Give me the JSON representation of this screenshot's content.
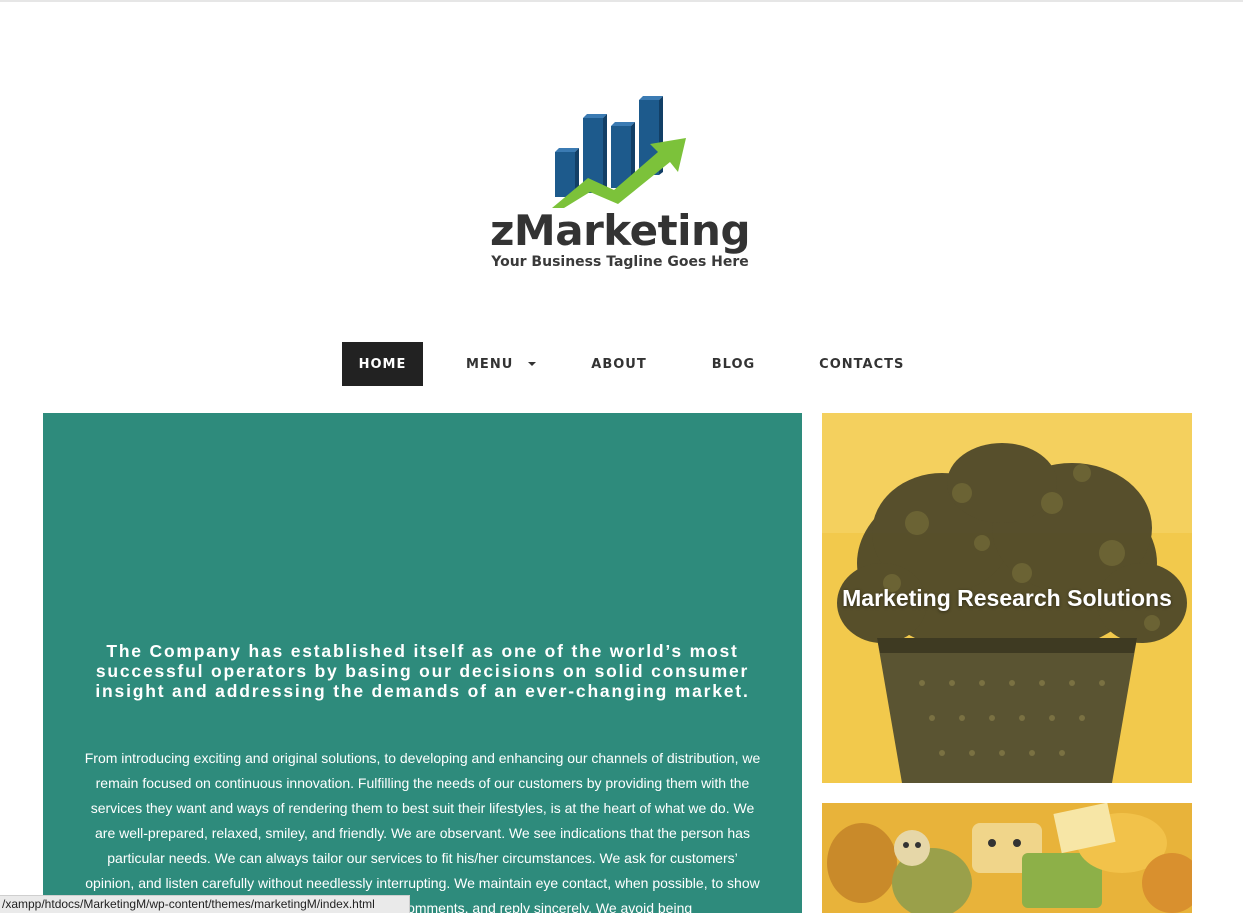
{
  "brand": {
    "name": "zMarketing",
    "tagline": "Your Business Tagline Goes Here",
    "colors": {
      "bars": "#1d5a8c",
      "arrow": "#7cc23a",
      "text": "#333333"
    }
  },
  "nav": {
    "items": [
      {
        "label": "HOME",
        "active": true
      },
      {
        "label": "MENU",
        "has_dropdown": true
      },
      {
        "label": "ABOUT"
      },
      {
        "label": "BLOG"
      },
      {
        "label": "CONTACTS"
      }
    ]
  },
  "main": {
    "background": "#2e8b7c",
    "heading": "The Company has established itself as one of the world’s most successful operators by basing our decisions on solid consumer insight and addressing the demands of an ever-changing market.",
    "body": "From introducing exciting and original solutions, to developing and enhancing our channels of distribution, we remain focused on continuous innovation. Fulfilling the needs of our customers by providing them with the services they want and ways of rendering them to best suit their lifestyles, is at the heart of what we do. We are well-prepared, relaxed, smiley, and friendly. We are observant. We see indications that the person has particular needs. We can always tailor our services to fit his/her circumstances. We ask for customers’ opinion, and listen carefully without needlessly interrupting. We maintain eye contact, when possible, to show a genuine interest. We acknowledge all comments, and reply sincerely. We avoid being"
  },
  "sidebar": {
    "cards": [
      {
        "label": "Marketing Research Solutions",
        "tint": "#f2c94c"
      },
      {
        "label": "",
        "tint": "#e8b33a"
      }
    ]
  },
  "status_bar": {
    "text": "/xampp/htdocs/MarketingM/wp-content/themes/marketingM/index.html"
  }
}
